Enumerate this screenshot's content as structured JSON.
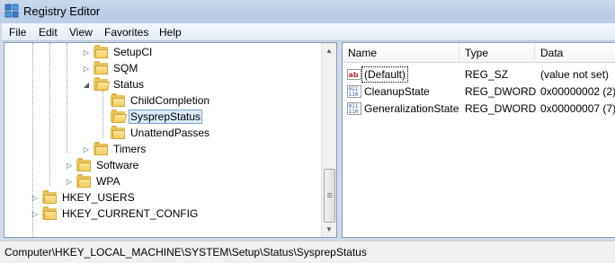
{
  "window": {
    "title": "Registry Editor"
  },
  "menu": [
    "File",
    "Edit",
    "View",
    "Favorites",
    "Help"
  ],
  "tree": [
    {
      "label": "SetupCI",
      "expander": "collapsed",
      "selected": false
    },
    {
      "label": "SQM",
      "expander": "collapsed",
      "selected": false
    },
    {
      "label": "Status",
      "expander": "expanded",
      "selected": false
    },
    {
      "label": "ChildCompletion",
      "expander": "none",
      "selected": false
    },
    {
      "label": "SysprepStatus",
      "expander": "none",
      "selected": true
    },
    {
      "label": "UnattendPasses",
      "expander": "none",
      "selected": false
    },
    {
      "label": "Timers",
      "expander": "collapsed",
      "selected": false
    },
    {
      "label": "Software",
      "expander": "collapsed",
      "selected": false
    },
    {
      "label": "WPA",
      "expander": "collapsed",
      "selected": false
    },
    {
      "label": "HKEY_USERS",
      "expander": "collapsed",
      "selected": false
    },
    {
      "label": "HKEY_CURRENT_CONFIG",
      "expander": "collapsed",
      "selected": false
    }
  ],
  "list": {
    "columns": [
      "Name",
      "Type",
      "Data"
    ],
    "rows": [
      {
        "name": "(Default)",
        "type": "REG_SZ",
        "data": "(value not set)",
        "icon": "string-value-icon"
      },
      {
        "name": "CleanupState",
        "type": "REG_DWORD",
        "data": "0x00000002 (2)",
        "icon": "binary-value-icon"
      },
      {
        "name": "GeneralizationState",
        "type": "REG_DWORD",
        "data": "0x00000007 (7)",
        "icon": "binary-value-icon"
      }
    ]
  },
  "status": {
    "path": "Computer\\HKEY_LOCAL_MACHINE\\SYSTEM\\Setup\\Status\\SysprepStatus"
  },
  "colors": {
    "title_bar": "#bcd0e8",
    "selection_fill": "#dcebfc",
    "selection_border": "#7da2ce",
    "folder": "#f2cd62"
  }
}
